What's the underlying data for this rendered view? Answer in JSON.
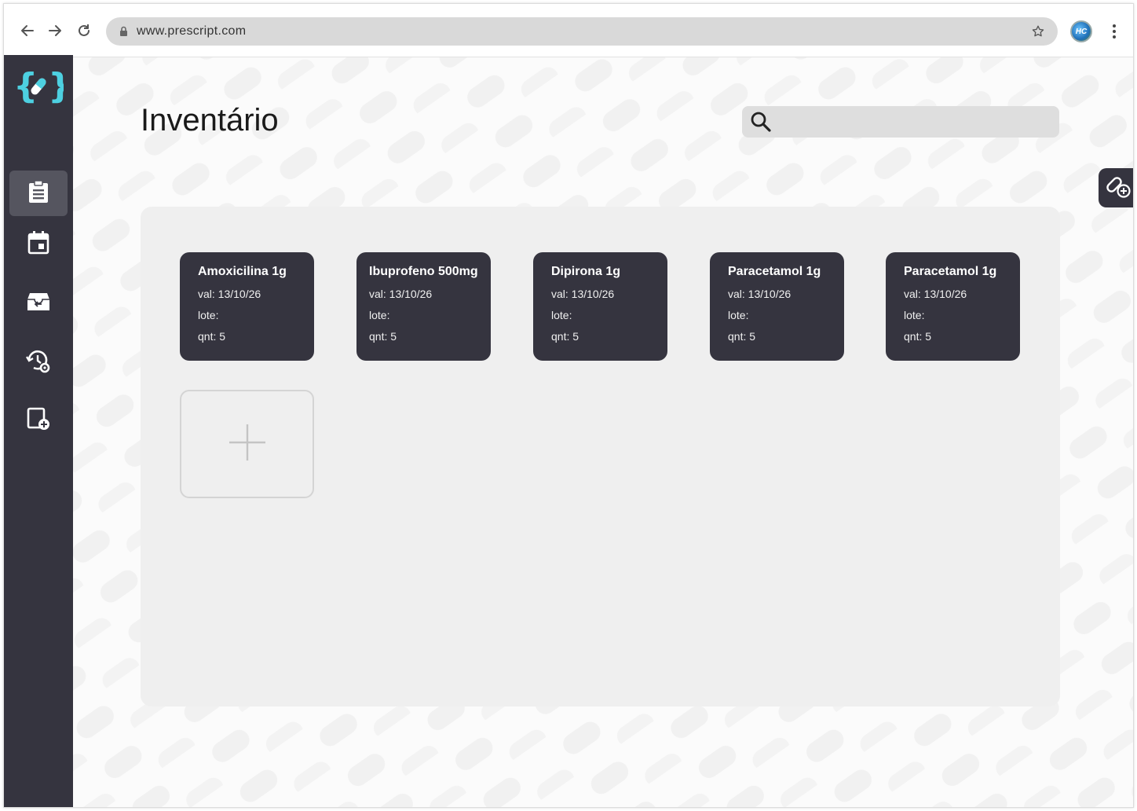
{
  "browser": {
    "url": "www.prescript.com",
    "profile_initials": "HC"
  },
  "sidebar": {
    "items": [
      {
        "name": "inventory",
        "icon": "clipboard-icon",
        "active": true
      },
      {
        "name": "calendar",
        "icon": "calendar-icon",
        "active": false
      },
      {
        "name": "archive",
        "icon": "archive-return-icon",
        "active": false
      },
      {
        "name": "history-settings",
        "icon": "history-settings-icon",
        "active": false
      },
      {
        "name": "add-document",
        "icon": "document-add-icon",
        "active": false
      }
    ]
  },
  "page": {
    "title": "Inventário",
    "search_placeholder": ""
  },
  "inventory": {
    "items": [
      {
        "name": "Amoxicilina 1g",
        "val": "val: 13/10/26",
        "lote": "lote:",
        "qnt": "qnt: 5"
      },
      {
        "name": "Ibuprofeno 500mg",
        "val": "val: 13/10/26",
        "lote": "lote:",
        "qnt": "qnt: 5"
      },
      {
        "name": "Dipirona 1g",
        "val": "val: 13/10/26",
        "lote": "lote:",
        "qnt": "qnt: 5"
      },
      {
        "name": "Paracetamol 1g",
        "val": "val: 13/10/26",
        "lote": "lote:",
        "qnt": "qnt: 5"
      },
      {
        "name": "Paracetamol 1g",
        "val": "val: 13/10/26",
        "lote": "lote:",
        "qnt": "qnt: 5"
      }
    ]
  },
  "colors": {
    "sidebar_bg": "#35343f",
    "accent_logo": "#4dd0e1",
    "panel_bg": "#efefef",
    "card_bg": "#35343f"
  }
}
